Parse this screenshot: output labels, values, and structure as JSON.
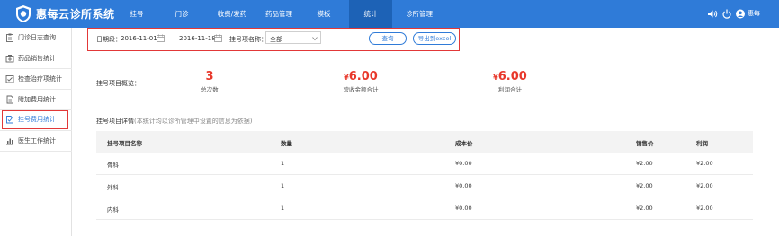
{
  "app": {
    "brand": "惠每云诊所系统",
    "user": "惠每"
  },
  "nav": [
    {
      "label": "挂号",
      "active": false
    },
    {
      "label": "门诊",
      "active": false
    },
    {
      "label": "收费/发药",
      "active": false
    },
    {
      "label": "药品管理",
      "active": false
    },
    {
      "label": "模板",
      "active": false
    },
    {
      "label": "统计",
      "active": true
    },
    {
      "label": "诊所管理",
      "active": false
    }
  ],
  "sidebar": {
    "items": [
      {
        "label": "门诊日志查询",
        "icon": "clipboard-icon",
        "active": false
      },
      {
        "label": "药品销售统计",
        "icon": "medicine-box-icon",
        "active": false
      },
      {
        "label": "检查治疗项统计",
        "icon": "checkup-icon",
        "active": false
      },
      {
        "label": "附加费用统计",
        "icon": "document-icon",
        "active": false
      },
      {
        "label": "挂号费用统计",
        "icon": "registration-icon",
        "active": true
      },
      {
        "label": "医生工作统计",
        "icon": "bar-chart-icon",
        "active": false
      }
    ]
  },
  "filter": {
    "date_label": "日期段：",
    "start_date": "2016-11-01",
    "separator": "—",
    "end_date": "2016-11-18",
    "item_label": "挂号项名称：",
    "item_value": "全部",
    "query_button": "查询",
    "export_button": "导出到excel"
  },
  "summary": {
    "label": "挂号项目概览：",
    "metrics": [
      {
        "value": "3",
        "currency": "",
        "label": "总次数"
      },
      {
        "value": "6.00",
        "currency": "¥",
        "label": "营收金额合计"
      },
      {
        "value": "6.00",
        "currency": "¥",
        "label": "利润合计"
      }
    ]
  },
  "detail": {
    "title": "挂号项目详情",
    "note": "(本统计均以诊所管理中设置的信息为依据)",
    "columns": [
      "挂号项目名称",
      "数量",
      "成本价",
      "销售价",
      "利润"
    ],
    "rows": [
      [
        "骨科",
        "1",
        "¥0.00",
        "¥2.00",
        "¥2.00"
      ],
      [
        "外科",
        "1",
        "¥0.00",
        "¥2.00",
        "¥2.00"
      ],
      [
        "内科",
        "1",
        "¥0.00",
        "¥2.00",
        "¥2.00"
      ]
    ]
  },
  "colors": {
    "primary": "#2f7bd8",
    "nav_active": "#1d62b6",
    "highlight": "#e23838",
    "metric": "#e8382b"
  }
}
